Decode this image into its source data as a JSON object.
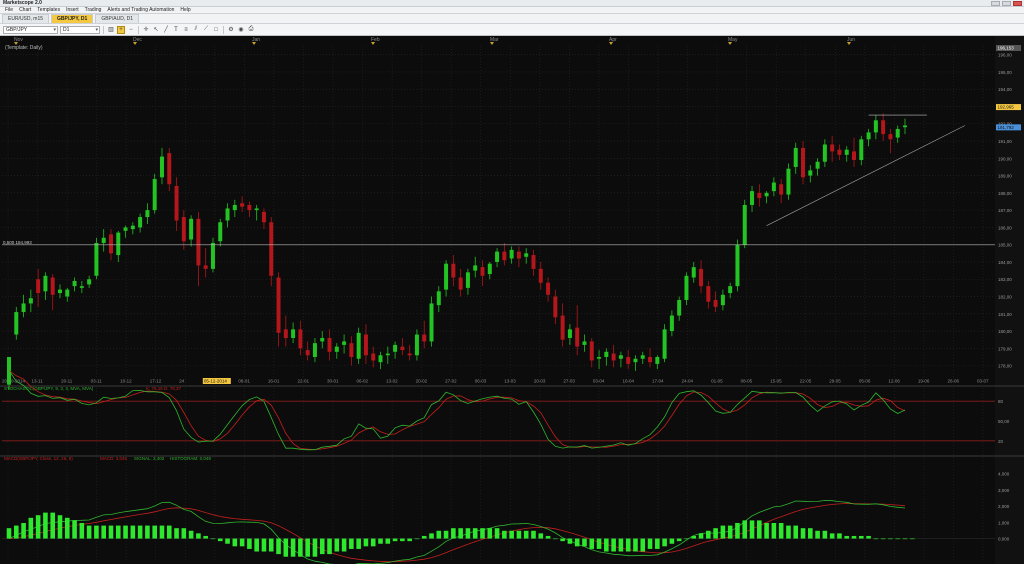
{
  "app": {
    "title": "Marketscope 2.0"
  },
  "menu": [
    "File",
    "Chart",
    "Templates",
    "Insert",
    "Trading",
    "Alerts and Trading Automation",
    "Help"
  ],
  "tabs": [
    {
      "label": "EUR/USD, m15",
      "active": false
    },
    {
      "label": "GBP/JPY, D1",
      "active": true
    },
    {
      "label": "GBP/AUD, D1",
      "active": false
    }
  ],
  "toolbar": {
    "symbol": "GBP/JPY",
    "timeframe": "D1",
    "icons": [
      "chart-type-icon",
      "zoom-in-icon",
      "zoom-out-icon",
      "crosshair-icon",
      "cursor-icon",
      "line-tool-icon",
      "text-tool-icon",
      "fibonacci-icon",
      "channel-icon",
      "trendline-icon",
      "shapes-icon",
      "settings-icon",
      "camera-icon",
      "print-icon"
    ]
  },
  "colors": {
    "bull": "#22c322",
    "bear": "#b3161b",
    "grid": "#262626",
    "accent": "#f5c842",
    "stoch_k": "#2fb52f",
    "stoch_d": "#c4201e"
  },
  "chart_data": {
    "type": "candlestick",
    "template_label": "(Template: Daily)",
    "months": [
      "Nov",
      "Dec",
      "Jan",
      "Feb",
      "Mar",
      "Apr",
      "May",
      "Jun"
    ],
    "date_ticks": [
      "20-10-2014",
      "13-11",
      "20-11",
      "03-11",
      "10-12",
      "17-12",
      "24",
      "05-12-2014",
      "08-01",
      "16-01",
      "22-01",
      "30-01",
      "06-02",
      "13-02",
      "20-02",
      "27-02",
      "06-03",
      "13-03",
      "20-03",
      "27-03",
      "03-04",
      "10-04",
      "17-04",
      "24-04",
      "01-05",
      "08-05",
      "15-05",
      "22-05",
      "29-05",
      "05-06",
      "12-06",
      "19-06",
      "26-06",
      "03-07"
    ],
    "date_highlight": "05-12-2014",
    "price_axis": [
      "196,00",
      "195,00",
      "194,00",
      "193,00",
      "192,00",
      "191,00",
      "190,00",
      "189,00",
      "188,00",
      "187,00",
      "186,00",
      "185,00",
      "184,00",
      "183,00",
      "182,00",
      "181,00",
      "180,00",
      "179,00",
      "178,00"
    ],
    "price_tags": [
      {
        "value": "192,965",
        "color": "#f5c842"
      },
      {
        "value": "191,792",
        "color": "#4a90d9"
      }
    ],
    "top_tag": "196,153",
    "horizontal_line_label": "0,500 184,993",
    "stochastic": {
      "label": "STOCHASTIC(GBP/JPY, 9, 3, 3, MVA, MVA)",
      "values_label": "K: 75,16  D: 78,37",
      "levels": [
        "80",
        "50,00",
        "20"
      ]
    },
    "macd": {
      "label": "MACD(GBP/JPY, Close, 12, 26, 9)",
      "macd_label": "MACD: 3,046",
      "signal_label": "SIGNAL: 3,402",
      "hist_label": "HISTOGRAM: 0,049",
      "levels": [
        "4,000",
        "3,000",
        "2,000",
        "1,000",
        "0,000"
      ]
    },
    "candles": [
      {
        "o": 176.9,
        "h": 178.1,
        "c": 178.5,
        "l": 176.6
      },
      {
        "o": 179.8,
        "h": 181.4,
        "c": 181.1,
        "l": 179.5
      },
      {
        "o": 181.1,
        "h": 182.1,
        "c": 181.6,
        "l": 180.8
      },
      {
        "o": 181.6,
        "h": 182.4,
        "c": 181.9,
        "l": 181.1
      },
      {
        "o": 183.0,
        "h": 183.6,
        "c": 182.2,
        "l": 181.4
      },
      {
        "o": 182.3,
        "h": 183.4,
        "c": 183.2,
        "l": 181.8
      },
      {
        "o": 183.1,
        "h": 183.3,
        "c": 182.1,
        "l": 181.2
      },
      {
        "o": 182.2,
        "h": 182.7,
        "c": 182.4,
        "l": 181.9
      },
      {
        "o": 182.0,
        "h": 182.5,
        "c": 182.4,
        "l": 181.7
      },
      {
        "o": 182.6,
        "h": 183.1,
        "c": 182.9,
        "l": 182.3
      },
      {
        "o": 182.5,
        "h": 182.9,
        "c": 182.6,
        "l": 182.2
      },
      {
        "o": 182.7,
        "h": 183.2,
        "c": 183.0,
        "l": 182.5
      },
      {
        "o": 183.2,
        "h": 185.4,
        "c": 185.1,
        "l": 183.0
      },
      {
        "o": 185.1,
        "h": 185.9,
        "c": 185.4,
        "l": 184.6
      },
      {
        "o": 185.6,
        "h": 185.9,
        "c": 184.5,
        "l": 184.1
      },
      {
        "o": 184.4,
        "h": 185.8,
        "c": 185.7,
        "l": 184.0
      },
      {
        "o": 185.8,
        "h": 186.1,
        "c": 186.0,
        "l": 185.4
      },
      {
        "o": 185.9,
        "h": 186.3,
        "c": 186.1,
        "l": 185.6
      },
      {
        "o": 186.0,
        "h": 186.8,
        "c": 186.6,
        "l": 185.7
      },
      {
        "o": 186.6,
        "h": 187.4,
        "c": 187.0,
        "l": 186.2
      },
      {
        "o": 187.0,
        "h": 189.1,
        "c": 188.8,
        "l": 186.8
      },
      {
        "o": 188.9,
        "h": 190.6,
        "c": 190.1,
        "l": 188.5
      },
      {
        "o": 190.3,
        "h": 190.6,
        "c": 188.5,
        "l": 188.1
      },
      {
        "o": 188.4,
        "h": 188.9,
        "c": 186.4,
        "l": 185.8
      },
      {
        "o": 186.6,
        "h": 187.0,
        "c": 185.2,
        "l": 184.7
      },
      {
        "o": 185.3,
        "h": 186.7,
        "c": 186.5,
        "l": 184.9
      },
      {
        "o": 186.5,
        "h": 186.9,
        "c": 183.8,
        "l": 182.6
      },
      {
        "o": 183.8,
        "h": 184.8,
        "c": 183.6,
        "l": 183.1
      },
      {
        "o": 183.6,
        "h": 185.4,
        "c": 185.1,
        "l": 183.4
      },
      {
        "o": 185.2,
        "h": 186.5,
        "c": 186.3,
        "l": 184.9
      },
      {
        "o": 186.4,
        "h": 187.4,
        "c": 187.1,
        "l": 186.0
      },
      {
        "o": 187.0,
        "h": 187.6,
        "c": 187.3,
        "l": 186.6
      },
      {
        "o": 187.4,
        "h": 187.8,
        "c": 187.2,
        "l": 186.9
      },
      {
        "o": 187.3,
        "h": 187.5,
        "c": 187.0,
        "l": 186.6
      },
      {
        "o": 187.0,
        "h": 187.3,
        "c": 187.1,
        "l": 186.4
      },
      {
        "o": 186.9,
        "h": 187.1,
        "c": 186.3,
        "l": 185.9
      },
      {
        "o": 186.3,
        "h": 186.6,
        "c": 183.2,
        "l": 182.6
      },
      {
        "o": 183.1,
        "h": 183.4,
        "c": 179.9,
        "l": 179.1
      },
      {
        "o": 180.1,
        "h": 180.9,
        "c": 179.6,
        "l": 179.1
      },
      {
        "o": 179.6,
        "h": 180.5,
        "c": 180.1,
        "l": 179.3
      },
      {
        "o": 180.1,
        "h": 180.6,
        "c": 179.0,
        "l": 178.6
      },
      {
        "o": 178.9,
        "h": 179.4,
        "c": 178.6,
        "l": 178.3
      },
      {
        "o": 178.5,
        "h": 179.6,
        "c": 179.3,
        "l": 178.2
      },
      {
        "o": 179.4,
        "h": 180.0,
        "c": 179.6,
        "l": 179.0
      },
      {
        "o": 179.6,
        "h": 180.1,
        "c": 178.8,
        "l": 178.3
      },
      {
        "o": 178.8,
        "h": 179.3,
        "c": 179.1,
        "l": 178.4
      },
      {
        "o": 179.2,
        "h": 179.8,
        "c": 179.4,
        "l": 178.7
      },
      {
        "o": 179.3,
        "h": 179.7,
        "c": 178.5,
        "l": 178.0
      },
      {
        "o": 178.4,
        "h": 180.2,
        "c": 179.9,
        "l": 178.1
      },
      {
        "o": 179.8,
        "h": 180.4,
        "c": 178.6,
        "l": 178.1
      },
      {
        "o": 178.7,
        "h": 179.1,
        "c": 178.3,
        "l": 177.9
      },
      {
        "o": 178.2,
        "h": 178.8,
        "c": 178.6,
        "l": 177.8
      },
      {
        "o": 178.6,
        "h": 179.1,
        "c": 178.7,
        "l": 178.1
      },
      {
        "o": 178.8,
        "h": 179.4,
        "c": 179.2,
        "l": 178.4
      },
      {
        "o": 179.1,
        "h": 179.6,
        "c": 178.9,
        "l": 178.6
      },
      {
        "o": 178.7,
        "h": 179.2,
        "c": 178.6,
        "l": 178.3
      },
      {
        "o": 178.6,
        "h": 180.1,
        "c": 179.8,
        "l": 178.3
      },
      {
        "o": 179.8,
        "h": 180.6,
        "c": 179.4,
        "l": 179.0
      },
      {
        "o": 179.4,
        "h": 182.0,
        "c": 181.6,
        "l": 179.1
      },
      {
        "o": 181.5,
        "h": 182.6,
        "c": 182.3,
        "l": 181.1
      },
      {
        "o": 182.4,
        "h": 184.1,
        "c": 183.9,
        "l": 182.0
      },
      {
        "o": 183.9,
        "h": 184.4,
        "c": 183.1,
        "l": 182.6
      },
      {
        "o": 183.1,
        "h": 183.6,
        "c": 182.4,
        "l": 182.0
      },
      {
        "o": 182.5,
        "h": 183.6,
        "c": 183.4,
        "l": 182.1
      },
      {
        "o": 183.5,
        "h": 184.3,
        "c": 183.8,
        "l": 183.1
      },
      {
        "o": 183.7,
        "h": 184.1,
        "c": 183.2,
        "l": 182.6
      },
      {
        "o": 183.3,
        "h": 184.0,
        "c": 183.9,
        "l": 183.0
      },
      {
        "o": 184.0,
        "h": 184.8,
        "c": 184.6,
        "l": 183.7
      },
      {
        "o": 184.6,
        "h": 185.1,
        "c": 184.1,
        "l": 183.8
      },
      {
        "o": 184.2,
        "h": 184.9,
        "c": 184.7,
        "l": 183.9
      },
      {
        "o": 184.6,
        "h": 184.9,
        "c": 184.2,
        "l": 183.7
      },
      {
        "o": 184.3,
        "h": 184.8,
        "c": 184.5,
        "l": 183.9
      },
      {
        "o": 184.4,
        "h": 184.7,
        "c": 183.6,
        "l": 183.2
      },
      {
        "o": 183.6,
        "h": 184.0,
        "c": 182.8,
        "l": 182.4
      },
      {
        "o": 182.8,
        "h": 183.1,
        "c": 182.1,
        "l": 181.7
      },
      {
        "o": 182.0,
        "h": 182.4,
        "c": 180.8,
        "l": 180.4
      },
      {
        "o": 180.9,
        "h": 181.6,
        "c": 179.5,
        "l": 179.1
      },
      {
        "o": 179.6,
        "h": 180.4,
        "c": 180.1,
        "l": 179.2
      },
      {
        "o": 180.2,
        "h": 181.5,
        "c": 179.1,
        "l": 178.6
      },
      {
        "o": 179.2,
        "h": 179.8,
        "c": 179.4,
        "l": 178.8
      },
      {
        "o": 179.4,
        "h": 179.6,
        "c": 178.3,
        "l": 177.9
      },
      {
        "o": 178.4,
        "h": 178.9,
        "c": 178.5,
        "l": 177.8
      },
      {
        "o": 178.5,
        "h": 179.0,
        "c": 178.8,
        "l": 178.0
      },
      {
        "o": 178.7,
        "h": 179.2,
        "c": 178.3,
        "l": 177.9
      },
      {
        "o": 178.4,
        "h": 178.8,
        "c": 178.6,
        "l": 177.9
      },
      {
        "o": 178.5,
        "h": 178.9,
        "c": 178.1,
        "l": 177.8
      },
      {
        "o": 178.2,
        "h": 178.6,
        "c": 178.4,
        "l": 177.7
      },
      {
        "o": 178.4,
        "h": 178.8,
        "c": 178.6,
        "l": 178.1
      },
      {
        "o": 178.5,
        "h": 179.0,
        "c": 178.2,
        "l": 177.9
      },
      {
        "o": 178.1,
        "h": 178.6,
        "c": 178.5,
        "l": 177.8
      },
      {
        "o": 178.4,
        "h": 180.4,
        "c": 180.1,
        "l": 178.2
      },
      {
        "o": 180.0,
        "h": 181.2,
        "c": 180.9,
        "l": 179.7
      },
      {
        "o": 180.9,
        "h": 182.0,
        "c": 181.8,
        "l": 180.6
      },
      {
        "o": 181.8,
        "h": 183.4,
        "c": 183.2,
        "l": 181.5
      },
      {
        "o": 183.1,
        "h": 184.0,
        "c": 183.7,
        "l": 182.8
      },
      {
        "o": 183.6,
        "h": 184.1,
        "c": 182.6,
        "l": 182.2
      },
      {
        "o": 182.6,
        "h": 182.9,
        "c": 181.7,
        "l": 181.3
      },
      {
        "o": 181.8,
        "h": 182.3,
        "c": 181.4,
        "l": 181.1
      },
      {
        "o": 181.5,
        "h": 182.4,
        "c": 182.1,
        "l": 181.2
      },
      {
        "o": 182.2,
        "h": 182.8,
        "c": 182.6,
        "l": 181.9
      },
      {
        "o": 182.6,
        "h": 185.3,
        "c": 185.0,
        "l": 182.3
      },
      {
        "o": 185.0,
        "h": 187.6,
        "c": 187.3,
        "l": 184.8
      },
      {
        "o": 187.3,
        "h": 188.4,
        "c": 188.1,
        "l": 186.9
      },
      {
        "o": 188.0,
        "h": 188.5,
        "c": 187.7,
        "l": 187.2
      },
      {
        "o": 187.8,
        "h": 188.1,
        "c": 188.0,
        "l": 187.4
      },
      {
        "o": 188.1,
        "h": 188.9,
        "c": 188.6,
        "l": 187.8
      },
      {
        "o": 188.5,
        "h": 188.8,
        "c": 187.9,
        "l": 187.4
      },
      {
        "o": 187.9,
        "h": 189.7,
        "c": 189.4,
        "l": 187.6
      },
      {
        "o": 189.5,
        "h": 190.9,
        "c": 190.6,
        "l": 189.1
      },
      {
        "o": 190.6,
        "h": 191.0,
        "c": 188.9,
        "l": 188.5
      },
      {
        "o": 189.0,
        "h": 189.6,
        "c": 189.3,
        "l": 188.6
      },
      {
        "o": 189.4,
        "h": 190.0,
        "c": 189.8,
        "l": 189.0
      },
      {
        "o": 189.8,
        "h": 191.1,
        "c": 190.8,
        "l": 189.5
      },
      {
        "o": 190.8,
        "h": 191.3,
        "c": 190.4,
        "l": 189.8
      },
      {
        "o": 190.5,
        "h": 190.8,
        "c": 190.2,
        "l": 189.9
      },
      {
        "o": 190.2,
        "h": 190.7,
        "c": 190.5,
        "l": 189.8
      },
      {
        "o": 190.4,
        "h": 191.2,
        "c": 189.9,
        "l": 189.5
      },
      {
        "o": 189.9,
        "h": 191.3,
        "c": 191.1,
        "l": 189.6
      },
      {
        "o": 191.1,
        "h": 191.7,
        "c": 191.5,
        "l": 190.7
      },
      {
        "o": 191.5,
        "h": 192.5,
        "c": 192.2,
        "l": 191.1
      },
      {
        "o": 192.2,
        "h": 192.6,
        "c": 191.4,
        "l": 191.0
      },
      {
        "o": 191.4,
        "h": 191.7,
        "c": 191.1,
        "l": 190.3
      },
      {
        "o": 191.2,
        "h": 191.9,
        "c": 191.7,
        "l": 190.9
      },
      {
        "o": 191.8,
        "h": 192.3,
        "c": 191.9,
        "l": 191.4
      }
    ],
    "macd_hist": [
      0.4,
      0.5,
      0.6,
      0.8,
      0.9,
      1.0,
      1.0,
      0.9,
      0.8,
      0.7,
      0.6,
      0.5,
      0.5,
      0.5,
      0.5,
      0.5,
      0.5,
      0.5,
      0.5,
      0.5,
      0.5,
      0.5,
      0.5,
      0.4,
      0.4,
      0.3,
      0.2,
      0.1,
      0.0,
      -0.1,
      -0.2,
      -0.3,
      -0.3,
      -0.4,
      -0.5,
      -0.5,
      -0.5,
      -0.6,
      -0.7,
      -0.7,
      -0.7,
      -0.7,
      -0.7,
      -0.6,
      -0.6,
      -0.5,
      -0.5,
      -0.4,
      -0.4,
      -0.3,
      -0.3,
      -0.2,
      -0.2,
      -0.1,
      -0.1,
      -0.1,
      0.0,
      0.1,
      0.2,
      0.3,
      0.3,
      0.4,
      0.4,
      0.4,
      0.4,
      0.4,
      0.4,
      0.4,
      0.3,
      0.3,
      0.3,
      0.3,
      0.3,
      0.2,
      0.1,
      0.0,
      -0.1,
      -0.2,
      -0.3,
      -0.3,
      -0.4,
      -0.4,
      -0.5,
      -0.5,
      -0.5,
      -0.5,
      -0.5,
      -0.5,
      -0.4,
      -0.4,
      -0.3,
      -0.2,
      -0.1,
      0.0,
      0.1,
      0.2,
      0.3,
      0.4,
      0.5,
      0.5,
      0.6,
      0.7,
      0.7,
      0.7,
      0.6,
      0.6,
      0.6,
      0.5,
      0.5,
      0.4,
      0.4,
      0.3,
      0.3,
      0.2,
      0.2,
      0.1,
      0.1,
      0.1,
      0.1,
      0.0,
      0.0,
      0.0,
      0.0,
      0.0,
      0.0
    ]
  }
}
